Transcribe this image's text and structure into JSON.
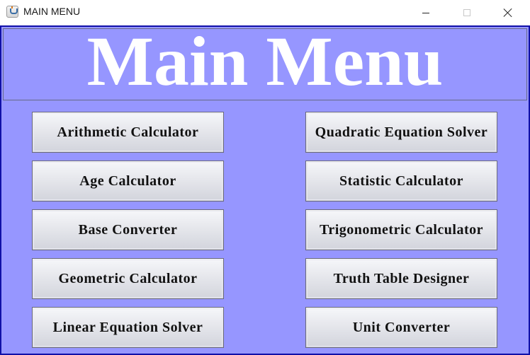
{
  "window": {
    "title": "MAIN MENU",
    "icon": "java-cup-icon"
  },
  "banner": {
    "heading": "Main Menu"
  },
  "menu": {
    "left": [
      "Arithmetic Calculator",
      "Age Calculator",
      "Base Converter",
      "Geometric Calculator",
      "Linear Equation Solver"
    ],
    "right": [
      "Quadratic Equation Solver",
      "Statistic Calculator",
      "Trigonometric Calculator",
      "Truth Table Designer",
      "Unit Converter"
    ]
  },
  "colors": {
    "background": "#9696ff",
    "border": "#1010a8",
    "heading": "#ffffff"
  }
}
